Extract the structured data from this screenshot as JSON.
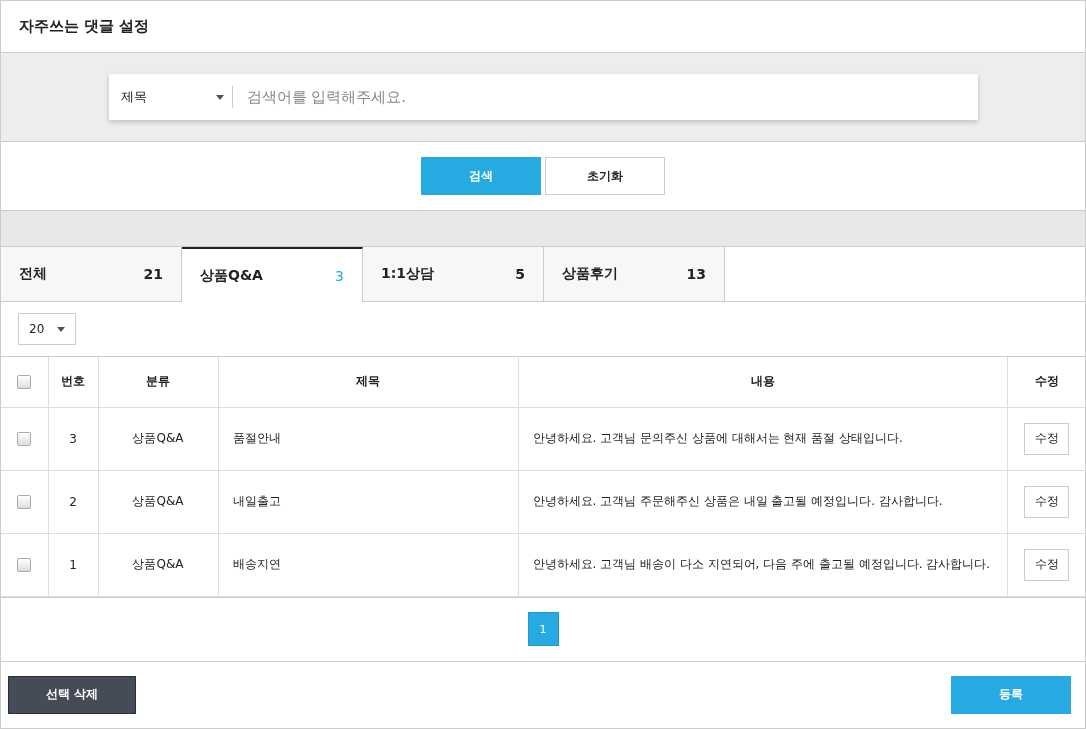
{
  "title": "자주쓰는 댓글 설정",
  "search": {
    "field_select": "제목",
    "placeholder": "검색어를 입력해주세요."
  },
  "search_buttons": [
    {
      "label": "검색",
      "kind": "primary"
    },
    {
      "label": "초기화",
      "kind": "secondary"
    }
  ],
  "tabs": [
    {
      "label": "전체",
      "count": "21",
      "selected": false
    },
    {
      "label": "상품Q&A",
      "count": "3",
      "selected": true
    },
    {
      "label": "1:1상담",
      "count": "5",
      "selected": false
    },
    {
      "label": "상품후기",
      "count": "13",
      "selected": false
    }
  ],
  "page_size": "20",
  "table": {
    "columns": [
      "번호",
      "분류",
      "제목",
      "내용",
      "수정"
    ],
    "header_checked": false,
    "rows": [
      {
        "checked": false,
        "number": "3",
        "category": "상품Q&A",
        "title": "품절안내",
        "content": "안녕하세요. 고객님 문의주신 상품에 대해서는 현재 품절 상태입니다.",
        "edit": "수정"
      },
      {
        "checked": false,
        "number": "2",
        "category": "상품Q&A",
        "title": "내일출고",
        "content": "안녕하세요. 고객님 주문해주신 상품은 내일 출고될 예정입니다. 감사합니다.",
        "edit": "수정"
      },
      {
        "checked": false,
        "number": "1",
        "category": "상품Q&A",
        "title": "배송지연",
        "content": "안녕하세요. 고객님 배송이 다소 지연되어, 다음 주에 출고될 예정입니다. 감사합니다.",
        "edit": "수정"
      }
    ]
  },
  "pagination": [
    {
      "label": "1",
      "selected": true
    }
  ],
  "footer_buttons": [
    {
      "label": "선택 삭제",
      "kind": "dark"
    },
    {
      "label": "등록",
      "kind": "primary"
    }
  ]
}
